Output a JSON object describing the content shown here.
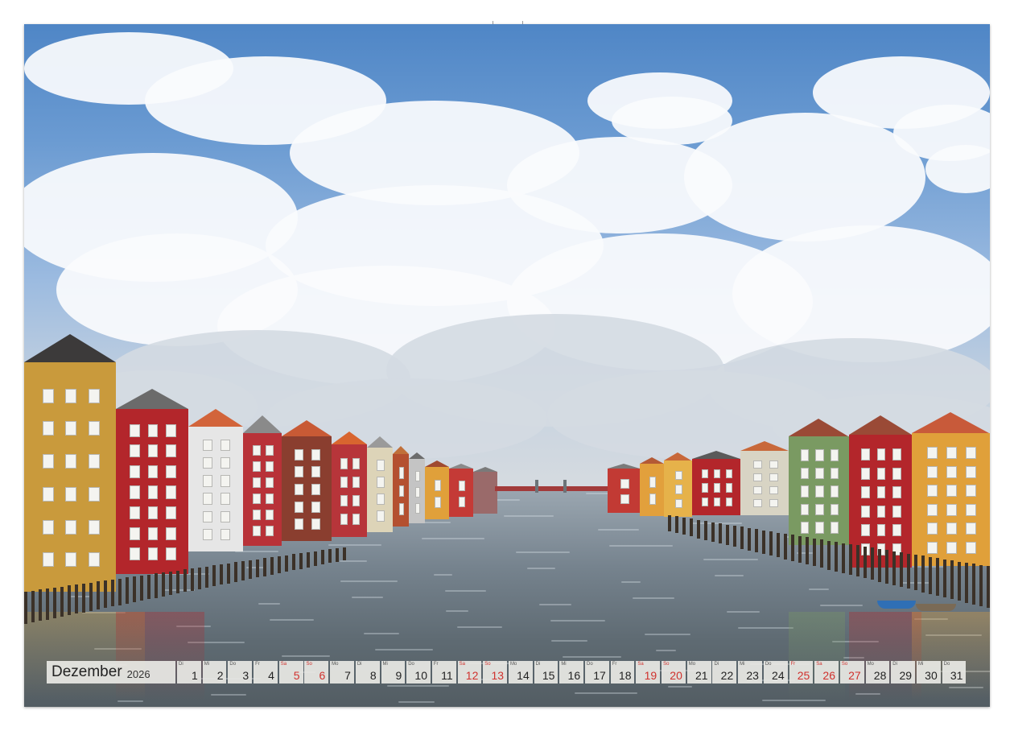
{
  "calendar": {
    "month": "Dezember",
    "year": "2026",
    "days": [
      {
        "wd": "Di",
        "d": "1",
        "we": false
      },
      {
        "wd": "Mi",
        "d": "2",
        "we": false
      },
      {
        "wd": "Do",
        "d": "3",
        "we": false
      },
      {
        "wd": "Fr",
        "d": "4",
        "we": false
      },
      {
        "wd": "Sa",
        "d": "5",
        "we": true
      },
      {
        "wd": "So",
        "d": "6",
        "we": true
      },
      {
        "wd": "Mo",
        "d": "7",
        "we": false
      },
      {
        "wd": "Di",
        "d": "8",
        "we": false
      },
      {
        "wd": "Mi",
        "d": "9",
        "we": false
      },
      {
        "wd": "Do",
        "d": "10",
        "we": false
      },
      {
        "wd": "Fr",
        "d": "11",
        "we": false
      },
      {
        "wd": "Sa",
        "d": "12",
        "we": true
      },
      {
        "wd": "So",
        "d": "13",
        "we": true
      },
      {
        "wd": "Mo",
        "d": "14",
        "we": false
      },
      {
        "wd": "Di",
        "d": "15",
        "we": false
      },
      {
        "wd": "Mi",
        "d": "16",
        "we": false
      },
      {
        "wd": "Do",
        "d": "17",
        "we": false
      },
      {
        "wd": "Fr",
        "d": "18",
        "we": false
      },
      {
        "wd": "Sa",
        "d": "19",
        "we": true
      },
      {
        "wd": "So",
        "d": "20",
        "we": true
      },
      {
        "wd": "Mo",
        "d": "21",
        "we": false
      },
      {
        "wd": "Di",
        "d": "22",
        "we": false
      },
      {
        "wd": "Mi",
        "d": "23",
        "we": false
      },
      {
        "wd": "Do",
        "d": "24",
        "we": false
      },
      {
        "wd": "Fr",
        "d": "25",
        "we": true
      },
      {
        "wd": "Sa",
        "d": "26",
        "we": true
      },
      {
        "wd": "So",
        "d": "27",
        "we": true
      },
      {
        "wd": "Mo",
        "d": "28",
        "we": false
      },
      {
        "wd": "Di",
        "d": "29",
        "we": false
      },
      {
        "wd": "Mi",
        "d": "30",
        "we": false
      },
      {
        "wd": "Do",
        "d": "31",
        "we": false
      }
    ]
  },
  "colors": {
    "weekend_red": "#d0312d",
    "wharf_yellow": "#c99a3c",
    "wharf_red": "#b3262b",
    "wharf_green": "#7a9a62",
    "wharf_orange": "#e0a03a"
  }
}
